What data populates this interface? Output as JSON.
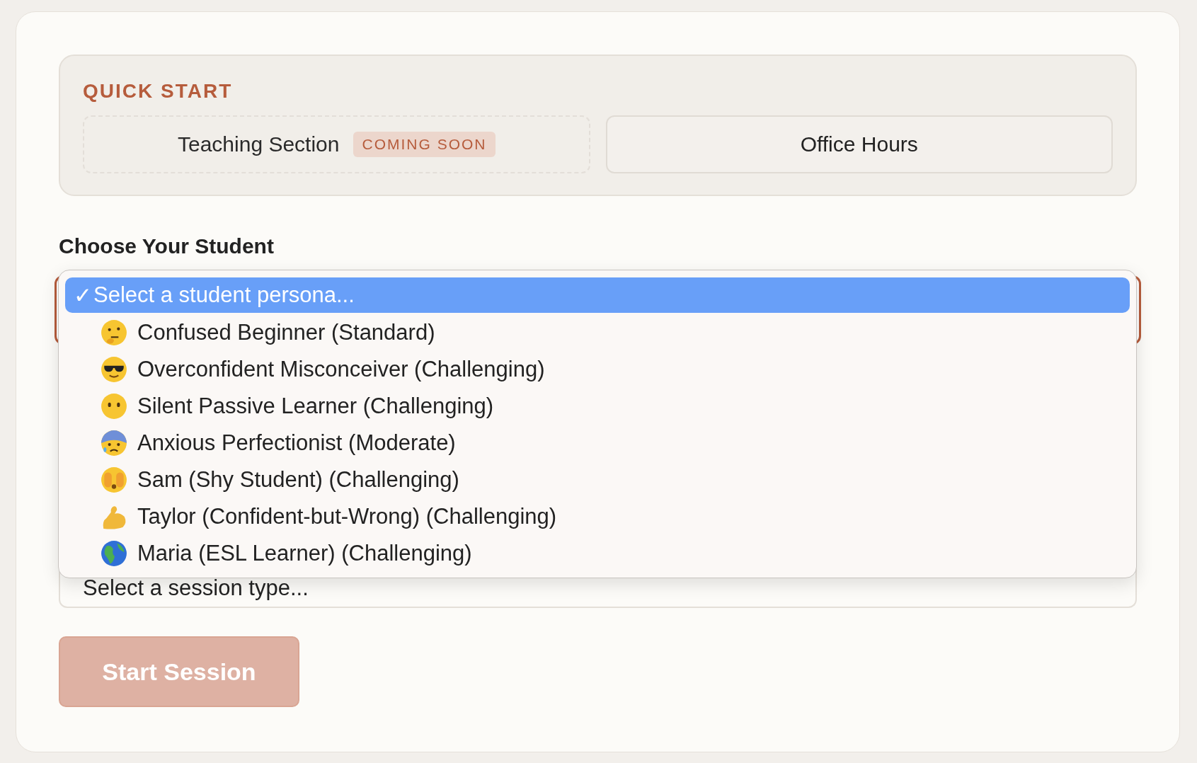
{
  "quick_start": {
    "title": "QUICK START",
    "options": [
      {
        "label": "Teaching Section",
        "badge": "COMING SOON",
        "disabled": true
      },
      {
        "label": "Office Hours",
        "disabled": false
      }
    ]
  },
  "student": {
    "label": "Choose Your Student",
    "check_mark": "✓",
    "options": [
      {
        "label": "Select a student persona...",
        "selected": true
      },
      {
        "label": "Confused Beginner (Standard)",
        "selected": false
      },
      {
        "label": "Overconfident Misconceiver (Challenging)",
        "selected": false
      },
      {
        "label": "Silent Passive Learner (Challenging)",
        "selected": false
      },
      {
        "label": "Anxious Perfectionist (Moderate)",
        "selected": false
      },
      {
        "label": "Sam (Shy Student) (Challenging)",
        "selected": false
      },
      {
        "label": "Taylor (Confident-but-Wrong) (Challenging)",
        "selected": false
      },
      {
        "label": "Maria (ESL Learner) (Challenging)",
        "selected": false
      }
    ]
  },
  "session": {
    "placeholder": "Select a session type..."
  },
  "start_button": {
    "label": "Start Session",
    "disabled": true
  }
}
